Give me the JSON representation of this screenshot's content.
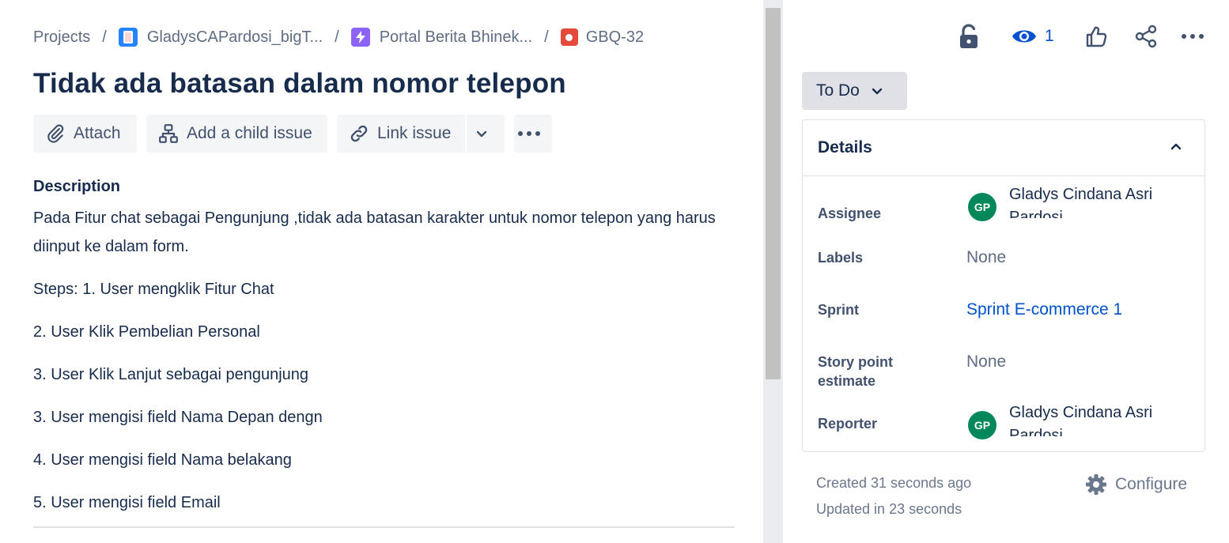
{
  "breadcrumb": {
    "projects": "Projects",
    "separator": "/",
    "project": "GladysCAPardosi_bigT...",
    "board": "Portal Berita Bhinek...",
    "issue_key": "GBQ-32"
  },
  "issue": {
    "title": "Tidak ada batasan dalam nomor telepon"
  },
  "toolbar": {
    "attach": "Attach",
    "add_child": "Add a child issue",
    "link_issue": "Link issue"
  },
  "description": {
    "label": "Description",
    "paragraphs": [
      "Pada Fitur chat sebagai Pengunjung ,tidak ada batasan karakter untuk nomor telepon yang harus diinput ke dalam form.",
      "Steps:  1. User mengklik Fitur Chat",
      "2. User Klik Pembelian Personal",
      "3. User Klik Lanjut sebagai pengunjung",
      "3. User mengisi field Nama Depan dengn",
      "4. User mengisi field Nama belakang",
      "5. User mengisi field Email"
    ]
  },
  "actions": {
    "watch_count": "1"
  },
  "status": {
    "label": "To Do"
  },
  "details": {
    "title": "Details",
    "assignee_label": "Assignee",
    "assignee_initials": "GP",
    "assignee_name": "Gladys Cindana Asri Pardosi",
    "labels_label": "Labels",
    "labels_value": "None",
    "sprint_label": "Sprint",
    "sprint_value": "Sprint E-commerce 1",
    "story_point_label": "Story point estimate",
    "story_point_value": "None",
    "reporter_label": "Reporter",
    "reporter_initials": "GP",
    "reporter_name": "Gladys Cindana Asri Pardosi"
  },
  "meta": {
    "created": "Created 31 seconds ago",
    "updated": "Updated in 23 seconds",
    "configure": "Configure"
  },
  "colors": {
    "text": "#172b4d",
    "link": "#0052cc",
    "avatar": "#00875a",
    "button_bg": "#f4f5f7"
  },
  "icons": [
    "project-icon",
    "lightning-icon",
    "bug-icon",
    "paperclip-icon",
    "hierarchy-icon",
    "link-icon",
    "chevron-down-icon",
    "more-icon",
    "lock-icon",
    "eye-icon",
    "thumbs-up-icon",
    "share-icon",
    "chevron-up-icon",
    "gear-icon"
  ]
}
